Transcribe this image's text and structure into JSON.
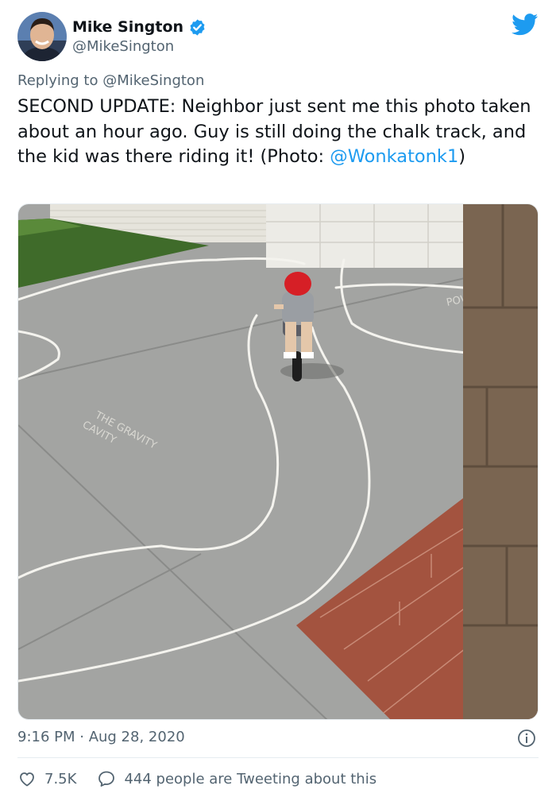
{
  "author": {
    "name": "Mike Sington",
    "handle": "@MikeSington",
    "verified": true
  },
  "reply": {
    "prefix": "Replying to",
    "to": "@MikeSington"
  },
  "tweet": {
    "text": "SECOND UPDATE: Neighbor just sent me this photo taken about an hour ago. Guy is still doing the chalk track, and the kid was there riding it! (Photo: ",
    "mention": "@Wonkatonk1",
    "suffix": ")"
  },
  "photo": {
    "chalk_words": [
      "THE GRAVITY",
      "CAVITY",
      "POW"
    ]
  },
  "meta": {
    "timestamp": "9:16 PM · Aug 28, 2020"
  },
  "actions": {
    "likes": "7.5K",
    "tweeting": "444 people are Tweeting about this"
  },
  "colors": {
    "link": "#1d9bf0",
    "muted": "#536471",
    "text": "#0f1419"
  }
}
